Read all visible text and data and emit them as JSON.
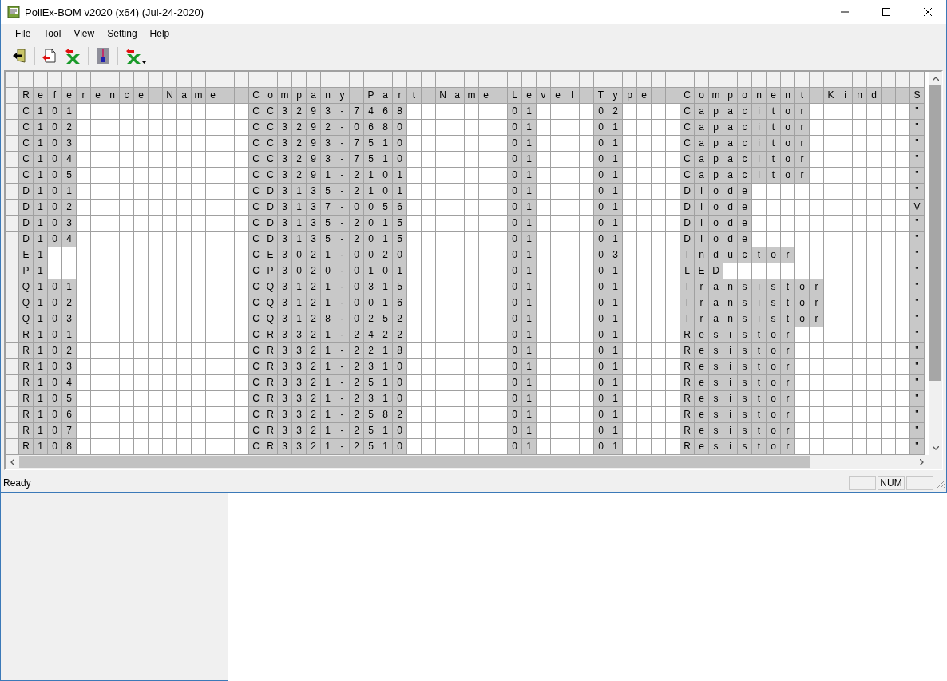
{
  "window": {
    "title": "PollEx-BOM v2020 (x64) (Jul-24-2020)"
  },
  "menu": [
    {
      "label": "File"
    },
    {
      "label": "Tool"
    },
    {
      "label": "View"
    },
    {
      "label": "Setting"
    },
    {
      "label": "Help"
    }
  ],
  "table": {
    "columns": [
      [
        [
          "R",
          "e",
          "f",
          "e",
          "r",
          "e",
          "n",
          "c",
          "e",
          null,
          "N",
          "a",
          "m",
          "e"
        ],
        [
          "C",
          "o",
          "m",
          "p",
          "a",
          "n",
          "y",
          null,
          "P",
          "a",
          "r",
          "t",
          null,
          "N",
          "a",
          "m",
          "e"
        ],
        [
          "L",
          "e",
          "v",
          "e",
          "l"
        ],
        [
          "T",
          "y",
          "p",
          "e"
        ],
        [
          "C",
          "o",
          "m",
          "p",
          "o",
          "n",
          "e",
          "n",
          "t",
          null,
          "K",
          "i",
          "n",
          "d"
        ],
        [
          "S"
        ]
      ]
    ],
    "rows": [
      [
        [
          "C",
          "1",
          "0",
          "1"
        ],
        [
          "C",
          "C",
          "3",
          "2",
          "9",
          "3",
          "-",
          "7",
          "4",
          "6",
          "8"
        ],
        [
          "0",
          "1"
        ],
        [
          "0",
          "2"
        ],
        [
          "C",
          "a",
          "p",
          "a",
          "c",
          "i",
          "t",
          "o",
          "r"
        ],
        [
          "\""
        ]
      ],
      [
        [
          "C",
          "1",
          "0",
          "2"
        ],
        [
          "C",
          "C",
          "3",
          "2",
          "9",
          "2",
          "-",
          "0",
          "6",
          "8",
          "0"
        ],
        [
          "0",
          "1"
        ],
        [
          "0",
          "1"
        ],
        [
          "C",
          "a",
          "p",
          "a",
          "c",
          "i",
          "t",
          "o",
          "r"
        ],
        [
          "\""
        ]
      ],
      [
        [
          "C",
          "1",
          "0",
          "3"
        ],
        [
          "C",
          "C",
          "3",
          "2",
          "9",
          "3",
          "-",
          "7",
          "5",
          "1",
          "0"
        ],
        [
          "0",
          "1"
        ],
        [
          "0",
          "1"
        ],
        [
          "C",
          "a",
          "p",
          "a",
          "c",
          "i",
          "t",
          "o",
          "r"
        ],
        [
          "\""
        ]
      ],
      [
        [
          "C",
          "1",
          "0",
          "4"
        ],
        [
          "C",
          "C",
          "3",
          "2",
          "9",
          "3",
          "-",
          "7",
          "5",
          "1",
          "0"
        ],
        [
          "0",
          "1"
        ],
        [
          "0",
          "1"
        ],
        [
          "C",
          "a",
          "p",
          "a",
          "c",
          "i",
          "t",
          "o",
          "r"
        ],
        [
          "\""
        ]
      ],
      [
        [
          "C",
          "1",
          "0",
          "5"
        ],
        [
          "C",
          "C",
          "3",
          "2",
          "9",
          "1",
          "-",
          "2",
          "1",
          "0",
          "1"
        ],
        [
          "0",
          "1"
        ],
        [
          "0",
          "1"
        ],
        [
          "C",
          "a",
          "p",
          "a",
          "c",
          "i",
          "t",
          "o",
          "r"
        ],
        [
          "\""
        ]
      ],
      [
        [
          "D",
          "1",
          "0",
          "1"
        ],
        [
          "C",
          "D",
          "3",
          "1",
          "3",
          "5",
          "-",
          "2",
          "1",
          "0",
          "1"
        ],
        [
          "0",
          "1"
        ],
        [
          "0",
          "1"
        ],
        [
          "D",
          "i",
          "o",
          "d",
          "e"
        ],
        [
          "\""
        ]
      ],
      [
        [
          "D",
          "1",
          "0",
          "2"
        ],
        [
          "C",
          "D",
          "3",
          "1",
          "3",
          "7",
          "-",
          "0",
          "0",
          "5",
          "6"
        ],
        [
          "0",
          "1"
        ],
        [
          "0",
          "1"
        ],
        [
          "D",
          "i",
          "o",
          "d",
          "e"
        ],
        [
          "V"
        ]
      ],
      [
        [
          "D",
          "1",
          "0",
          "3"
        ],
        [
          "C",
          "D",
          "3",
          "1",
          "3",
          "5",
          "-",
          "2",
          "0",
          "1",
          "5"
        ],
        [
          "0",
          "1"
        ],
        [
          "0",
          "1"
        ],
        [
          "D",
          "i",
          "o",
          "d",
          "e"
        ],
        [
          "\""
        ]
      ],
      [
        [
          "D",
          "1",
          "0",
          "4"
        ],
        [
          "C",
          "D",
          "3",
          "1",
          "3",
          "5",
          "-",
          "2",
          "0",
          "1",
          "5"
        ],
        [
          "0",
          "1"
        ],
        [
          "0",
          "1"
        ],
        [
          "D",
          "i",
          "o",
          "d",
          "e"
        ],
        [
          "\""
        ]
      ],
      [
        [
          "E",
          "1"
        ],
        [
          "C",
          "E",
          "3",
          "0",
          "2",
          "1",
          "-",
          "0",
          "0",
          "2",
          "0"
        ],
        [
          "0",
          "1"
        ],
        [
          "0",
          "3"
        ],
        [
          "I",
          "n",
          "d",
          "u",
          "c",
          "t",
          "o",
          "r"
        ],
        [
          "\""
        ]
      ],
      [
        [
          "P",
          "1"
        ],
        [
          "C",
          "P",
          "3",
          "0",
          "2",
          "0",
          "-",
          "0",
          "1",
          "0",
          "1"
        ],
        [
          "0",
          "1"
        ],
        [
          "0",
          "1"
        ],
        [
          "L",
          "E",
          "D"
        ],
        [
          "\""
        ]
      ],
      [
        [
          "Q",
          "1",
          "0",
          "1"
        ],
        [
          "C",
          "Q",
          "3",
          "1",
          "2",
          "1",
          "-",
          "0",
          "3",
          "1",
          "5"
        ],
        [
          "0",
          "1"
        ],
        [
          "0",
          "1"
        ],
        [
          "T",
          "r",
          "a",
          "n",
          "s",
          "i",
          "s",
          "t",
          "o",
          "r"
        ],
        [
          "\""
        ]
      ],
      [
        [
          "Q",
          "1",
          "0",
          "2"
        ],
        [
          "C",
          "Q",
          "3",
          "1",
          "2",
          "1",
          "-",
          "0",
          "0",
          "1",
          "6"
        ],
        [
          "0",
          "1"
        ],
        [
          "0",
          "1"
        ],
        [
          "T",
          "r",
          "a",
          "n",
          "s",
          "i",
          "s",
          "t",
          "o",
          "r"
        ],
        [
          "\""
        ]
      ],
      [
        [
          "Q",
          "1",
          "0",
          "3"
        ],
        [
          "C",
          "Q",
          "3",
          "1",
          "2",
          "8",
          "-",
          "0",
          "2",
          "5",
          "2"
        ],
        [
          "0",
          "1"
        ],
        [
          "0",
          "1"
        ],
        [
          "T",
          "r",
          "a",
          "n",
          "s",
          "i",
          "s",
          "t",
          "o",
          "r"
        ],
        [
          "\""
        ]
      ],
      [
        [
          "R",
          "1",
          "0",
          "1"
        ],
        [
          "C",
          "R",
          "3",
          "3",
          "2",
          "1",
          "-",
          "2",
          "4",
          "2",
          "2"
        ],
        [
          "0",
          "1"
        ],
        [
          "0",
          "1"
        ],
        [
          "R",
          "e",
          "s",
          "i",
          "s",
          "t",
          "o",
          "r"
        ],
        [
          "\""
        ]
      ],
      [
        [
          "R",
          "1",
          "0",
          "2"
        ],
        [
          "C",
          "R",
          "3",
          "3",
          "2",
          "1",
          "-",
          "2",
          "2",
          "1",
          "8"
        ],
        [
          "0",
          "1"
        ],
        [
          "0",
          "1"
        ],
        [
          "R",
          "e",
          "s",
          "i",
          "s",
          "t",
          "o",
          "r"
        ],
        [
          "\""
        ]
      ],
      [
        [
          "R",
          "1",
          "0",
          "3"
        ],
        [
          "C",
          "R",
          "3",
          "3",
          "2",
          "1",
          "-",
          "2",
          "3",
          "1",
          "0"
        ],
        [
          "0",
          "1"
        ],
        [
          "0",
          "1"
        ],
        [
          "R",
          "e",
          "s",
          "i",
          "s",
          "t",
          "o",
          "r"
        ],
        [
          "\""
        ]
      ],
      [
        [
          "R",
          "1",
          "0",
          "4"
        ],
        [
          "C",
          "R",
          "3",
          "3",
          "2",
          "1",
          "-",
          "2",
          "5",
          "1",
          "0"
        ],
        [
          "0",
          "1"
        ],
        [
          "0",
          "1"
        ],
        [
          "R",
          "e",
          "s",
          "i",
          "s",
          "t",
          "o",
          "r"
        ],
        [
          "\""
        ]
      ],
      [
        [
          "R",
          "1",
          "0",
          "5"
        ],
        [
          "C",
          "R",
          "3",
          "3",
          "2",
          "1",
          "-",
          "2",
          "3",
          "1",
          "0"
        ],
        [
          "0",
          "1"
        ],
        [
          "0",
          "1"
        ],
        [
          "R",
          "e",
          "s",
          "i",
          "s",
          "t",
          "o",
          "r"
        ],
        [
          "\""
        ]
      ],
      [
        [
          "R",
          "1",
          "0",
          "6"
        ],
        [
          "C",
          "R",
          "3",
          "3",
          "2",
          "1",
          "-",
          "2",
          "5",
          "8",
          "2"
        ],
        [
          "0",
          "1"
        ],
        [
          "0",
          "1"
        ],
        [
          "R",
          "e",
          "s",
          "i",
          "s",
          "t",
          "o",
          "r"
        ],
        [
          "\""
        ]
      ],
      [
        [
          "R",
          "1",
          "0",
          "7"
        ],
        [
          "C",
          "R",
          "3",
          "3",
          "2",
          "1",
          "-",
          "2",
          "5",
          "1",
          "0"
        ],
        [
          "0",
          "1"
        ],
        [
          "0",
          "1"
        ],
        [
          "R",
          "e",
          "s",
          "i",
          "s",
          "t",
          "o",
          "r"
        ],
        [
          "\""
        ]
      ],
      [
        [
          "R",
          "1",
          "0",
          "8"
        ],
        [
          "C",
          "R",
          "3",
          "3",
          "2",
          "1",
          "-",
          "2",
          "5",
          "1",
          "0"
        ],
        [
          "0",
          "1"
        ],
        [
          "0",
          "1"
        ],
        [
          "R",
          "e",
          "s",
          "i",
          "s",
          "t",
          "o",
          "r"
        ],
        [
          "\""
        ]
      ]
    ]
  },
  "status_bar": {
    "text": "Ready",
    "indicators": [
      "NUM"
    ]
  }
}
